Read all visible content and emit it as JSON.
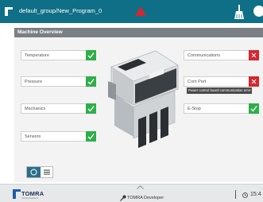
{
  "topbar": {
    "path": "default_group/New_Program_0",
    "alert_icon": "warning-triangle-icon",
    "clean_icon": "broom-icon",
    "help_icon": "help-icon"
  },
  "header": {
    "title": "Machine Overview"
  },
  "status_items": {
    "temperature": {
      "label": "Temperature",
      "state": "ok"
    },
    "pressure": {
      "label": "Pressure",
      "state": "ok"
    },
    "mechanics": {
      "label": "Mechanics",
      "state": "ok"
    },
    "sensors": {
      "label": "Sensors",
      "state": "ok"
    },
    "communications": {
      "label": "Communications",
      "state": "error"
    },
    "com_port": {
      "label": "Com Port",
      "state": "error"
    },
    "estop": {
      "label": "E-Stop",
      "state": "ok"
    }
  },
  "tooltip": {
    "text": "Power control board communication error"
  },
  "machine": {
    "brand_small": "TOMRA"
  },
  "view_toggle": {
    "icons": [
      "dashboard-icon",
      "list-icon"
    ]
  },
  "footer": {
    "brand": "TOMRA",
    "tagline": "Sorting Solutions",
    "user_label": "TOMRA Developer",
    "time": "15:4"
  },
  "colors": {
    "ok": "#2fae4a",
    "error": "#d6262f",
    "topbar": "#0f6f86",
    "header": "#7a7f84"
  }
}
